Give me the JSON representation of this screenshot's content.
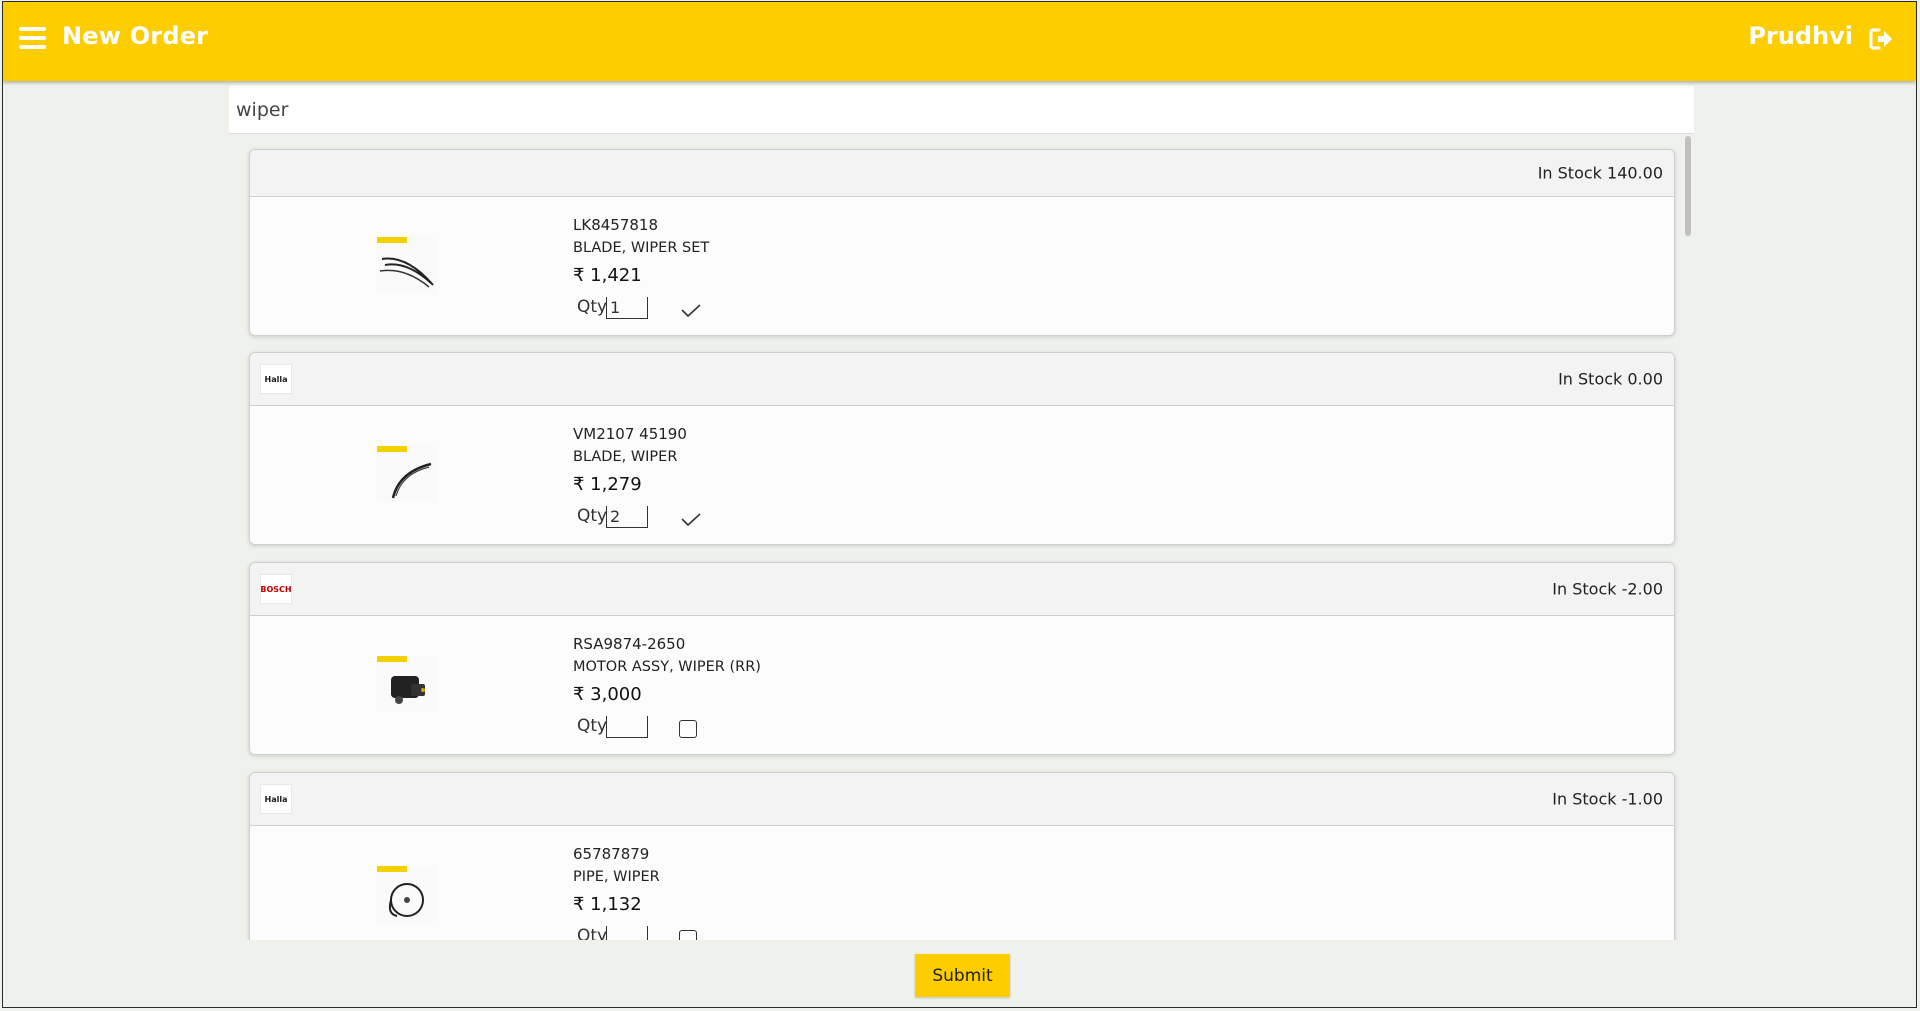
{
  "appbar": {
    "title": "New Order",
    "user": "Prudhvi",
    "menu_icon": "hamburger-menu-icon",
    "logout_icon": "logout-icon"
  },
  "search": {
    "value": "wiper",
    "placeholder": ""
  },
  "items": [
    {
      "brand": "",
      "stock": "In Stock 140.00",
      "part_no": "LK8457818",
      "desc": "BLADE, WIPER SET",
      "price": "₹ 1,421",
      "qty_label": "Qty",
      "qty": "1",
      "selected": true
    },
    {
      "brand": "Halla",
      "stock": "In Stock 0.00",
      "part_no": "VM2107 45190",
      "desc": "BLADE, WIPER",
      "price": "₹ 1,279",
      "qty_label": "Qty",
      "qty": "2",
      "selected": true
    },
    {
      "brand": "BOSCH",
      "stock": "In Stock -2.00",
      "part_no": "RSA9874-2650",
      "desc": "MOTOR ASSY, WIPER (RR)",
      "price": "₹ 3,000",
      "qty_label": "Qty",
      "qty": "",
      "selected": false
    },
    {
      "brand": "Halla",
      "stock": "In Stock -1.00",
      "part_no": "65787879",
      "desc": "PIPE, WIPER",
      "price": "₹ 1,132",
      "qty_label": "Qty",
      "qty": "",
      "selected": false
    }
  ],
  "submit_label": "Submit",
  "colors": {
    "accent": "#fecd00",
    "background": "#eef1ec"
  }
}
